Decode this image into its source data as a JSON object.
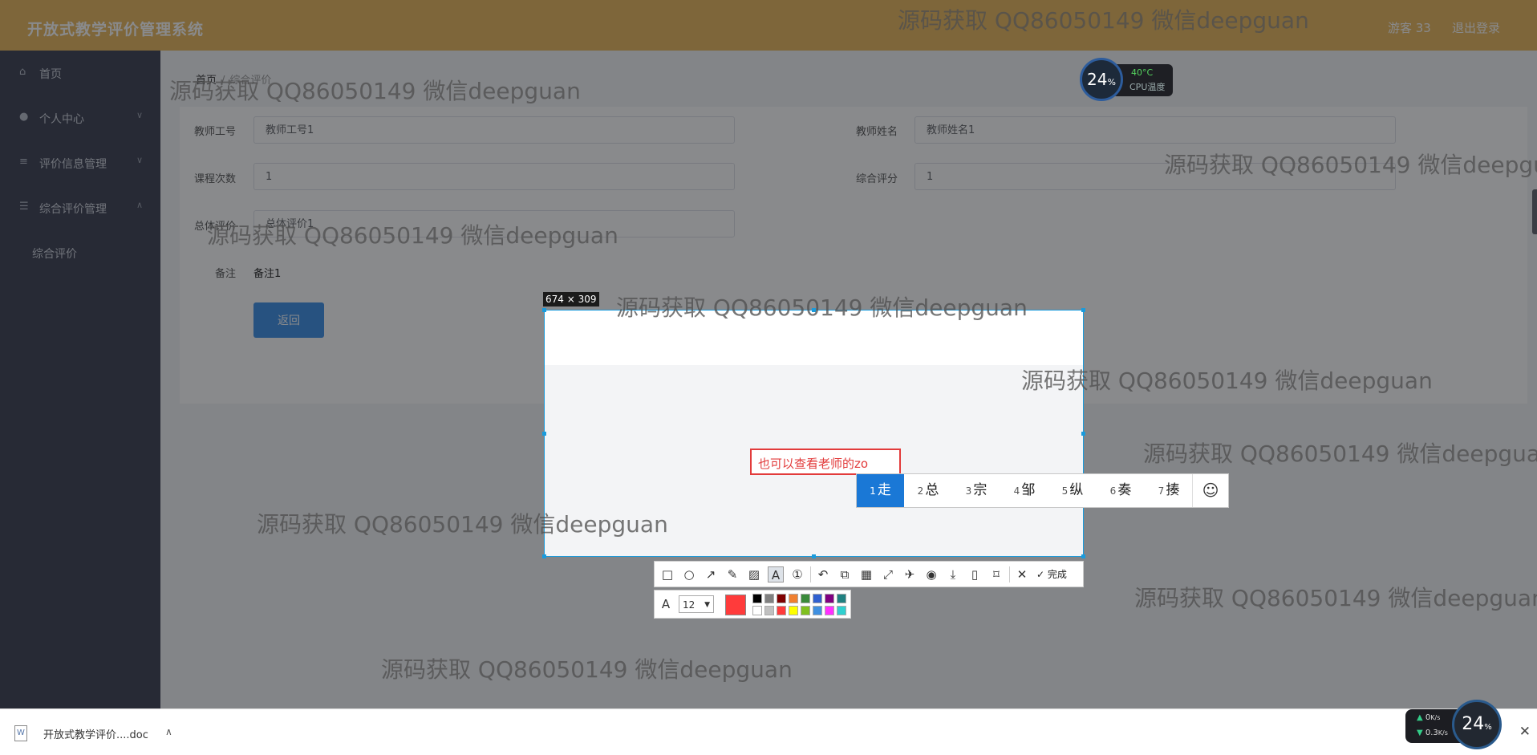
{
  "app": {
    "title": "开放式教学评价管理系统",
    "user": "游客 33",
    "logout": "退出登录"
  },
  "sidebar": {
    "items": [
      {
        "label": "首页",
        "icon": "home-icon"
      },
      {
        "label": "个人中心",
        "icon": "user-icon"
      },
      {
        "label": "评价信息管理",
        "icon": "sliders-icon"
      },
      {
        "label": "综合评价管理",
        "icon": "list-icon"
      },
      {
        "label": "综合评价",
        "icon": ""
      }
    ]
  },
  "breadcrumb": {
    "home": "首页",
    "current": "综合评价"
  },
  "form": {
    "teacher_no_label": "教师工号",
    "teacher_no": "教师工号1",
    "teacher_name_label": "教师姓名",
    "teacher_name": "教师姓名1",
    "course_count_label": "课程次数",
    "course_count": "1",
    "score_label": "综合评分",
    "score": "1",
    "overall_label": "总体评价",
    "overall": "总体评价1",
    "remark_label": "备注",
    "remark": "备注1",
    "back": "返回"
  },
  "cpu": {
    "percent": "24",
    "unit": "%",
    "temp": "40°C",
    "label": "CPU温度"
  },
  "capture": {
    "size": "674 × 309",
    "text": "也可以查看老师的zo",
    "ime_candidates": [
      {
        "num": "1",
        "char": "走"
      },
      {
        "num": "2",
        "char": "总"
      },
      {
        "num": "3",
        "char": "宗"
      },
      {
        "num": "4",
        "char": "邹"
      },
      {
        "num": "5",
        "char": "纵"
      },
      {
        "num": "6",
        "char": "奏"
      },
      {
        "num": "7",
        "char": "揍"
      }
    ],
    "done": "完成",
    "font_size": "12",
    "current_color": "#ff3b3b",
    "palette_top": [
      "#000000",
      "#808080",
      "#800000",
      "#f08030",
      "#3a8a3a",
      "#3060d0",
      "#800080",
      "#208080"
    ],
    "palette_bottom": [
      "#ffffff",
      "#c0c0c0",
      "#ff3b3b",
      "#ffff00",
      "#80c020",
      "#4090e0",
      "#ff30ff",
      "#30d0d0"
    ]
  },
  "watermark": "源码获取 QQ86050149 微信deepguan",
  "download": {
    "file": "开放式教学评价....doc"
  },
  "net": {
    "up": "0",
    "up_unit": "K/s",
    "down": "0.3",
    "down_unit": "K/s",
    "percent": "24",
    "unit": "%"
  }
}
